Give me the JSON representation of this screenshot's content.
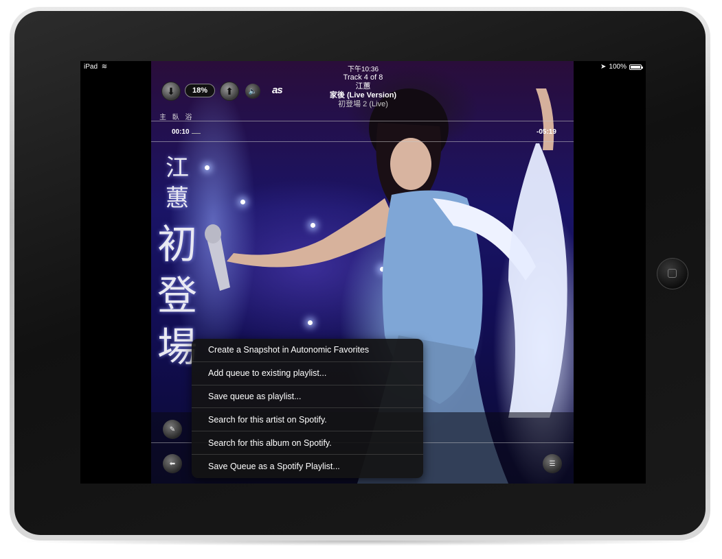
{
  "status_bar": {
    "device": "iPad",
    "time": "下午10:36",
    "battery": "100%"
  },
  "now_playing": {
    "track_position": "Track 4 of 8",
    "artist": "江蕙",
    "title": "家後 (Live Version)",
    "album": "初登場 2 (Live)",
    "artist_label": "主 臥 浴"
  },
  "controls": {
    "down_icon": "arrow-down-icon",
    "volume_percent": "18%",
    "up_icon": "arrow-up-icon",
    "speaker_icon": "speaker-icon",
    "lastfm_logo": "as"
  },
  "progress": {
    "elapsed": "00:10",
    "remaining": "-05:19",
    "fraction": 0.03
  },
  "album_art_text": {
    "line1": "江",
    "line2": "蕙",
    "line3": "初",
    "line4": "登",
    "line5": "場"
  },
  "context_menu": {
    "items": [
      "Create a Snapshot in Autonomic Favorites",
      "Add queue to existing playlist...",
      "Save queue as playlist...",
      "Search for this artist on Spotify.",
      "Search for this album on Spotify.",
      "Save Queue as a Spotify Playlist..."
    ]
  },
  "colors": {
    "bezel": "#141414",
    "menu_bg": "#1a1a1a",
    "text": "#ffffff"
  }
}
